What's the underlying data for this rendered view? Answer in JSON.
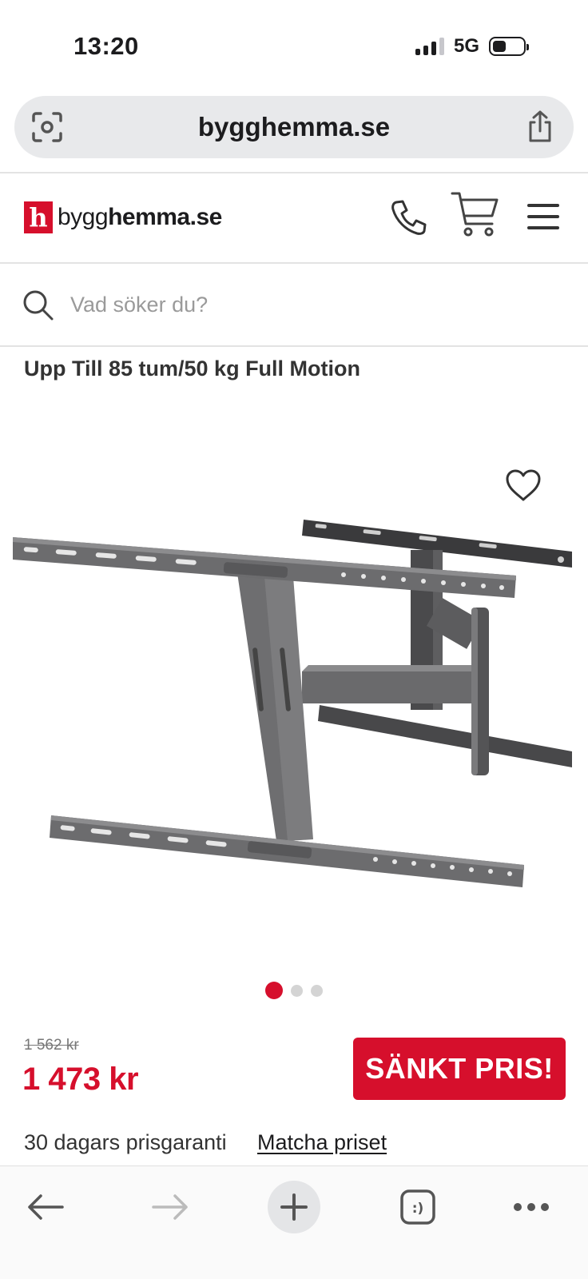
{
  "status_bar": {
    "time": "13:20",
    "network": "5G"
  },
  "browser": {
    "url": "bygghemma.se"
  },
  "site": {
    "logo_letter": "h",
    "logo_light": "bygg",
    "logo_bold": "hemma.se"
  },
  "search": {
    "placeholder": "Vad söker du?"
  },
  "product": {
    "title": "Upp Till 85 tum/50 kg Full Motion",
    "old_price": "1 562 kr",
    "price": "1 473 kr",
    "badge": "SÄNKT PRIS!",
    "image_count": 3,
    "active_image": 1
  },
  "guarantee": {
    "text": "30 dagars prisgaranti",
    "link": "Matcha priset"
  },
  "colors": {
    "accent": "#d60f2c",
    "text": "#1c1c1e",
    "url_bar_bg": "#e8e9eb"
  },
  "icons": [
    "scan-icon",
    "share-icon",
    "phone-icon",
    "cart-icon",
    "menu-icon",
    "search-icon",
    "heart-icon",
    "back-icon",
    "forward-icon",
    "plus-icon",
    "tabs-icon",
    "more-icon"
  ]
}
